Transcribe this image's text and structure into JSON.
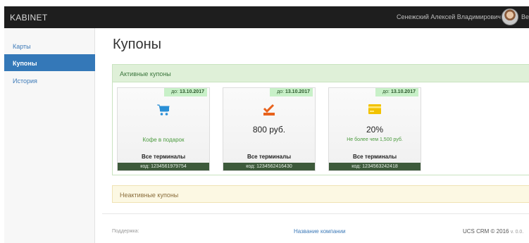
{
  "header": {
    "brand": "KABINET",
    "user_name": "Сенежский Алексей Владимирович",
    "extra": "Ве"
  },
  "sidebar": {
    "items": [
      {
        "label": "Карты",
        "active": false
      },
      {
        "label": "Купоны",
        "active": true
      },
      {
        "label": "История",
        "active": false
      }
    ]
  },
  "page_title": "Купоны",
  "active_panel": {
    "title": "Активные купоны",
    "cards": [
      {
        "date_prefix": "до:",
        "date": "13.10.2017",
        "icon": "cart-icon",
        "value": "",
        "subtitle": "Кофе в подарок",
        "terminals": "Все терминалы",
        "code": "код: 1234561979754"
      },
      {
        "date_prefix": "до:",
        "date": "13.10.2017",
        "icon": "checkmark-icon",
        "value": "800 руб.",
        "subtitle": "",
        "terminals": "Все терминалы",
        "code": "код: 1234562416430"
      },
      {
        "date_prefix": "до:",
        "date": "13.10.2017",
        "icon": "credit-card-icon",
        "value": "20%",
        "subtitle": "Не более чем 1,500 руб.",
        "terminals": "Все терминалы",
        "code": "код: 1234563242418"
      }
    ]
  },
  "inactive_panel": {
    "title": "Неактивные купоны"
  },
  "footer": {
    "support": "Поддержка:",
    "company": "Название компании",
    "crm": "UCS CRM © 2016",
    "version": "v. 0.0."
  },
  "colors": {
    "topbar": "#1e1e1e",
    "sidebar_active": "#3478b8",
    "active_panel_header": "#dff0d8",
    "inactive_panel": "#fcf8e3",
    "code_bar": "#3d5a3b",
    "cart_icon": "#2a8fd6",
    "check_icon": "#e8621c",
    "card_icon": "#f2c200"
  }
}
